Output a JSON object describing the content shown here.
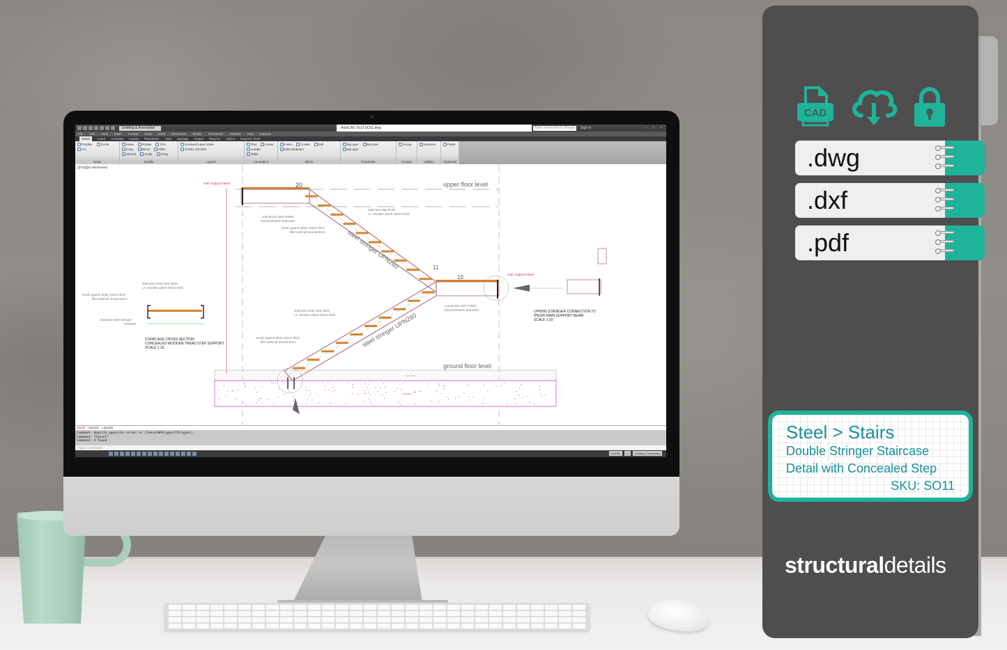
{
  "colors": {
    "brand_teal": "#1fb39a",
    "panel_dark": "#4e4e4f",
    "card_text": "#1a8f9c"
  },
  "product_panel": {
    "icons": [
      "cad-file-icon",
      "cloud-download-icon",
      "lock-icon"
    ],
    "cad_icon_text": "CAD",
    "formats": [
      ".dwg",
      ".dxf",
      ".pdf"
    ],
    "category": "Steel > Stairs",
    "title_line1": "Double Stringer Staircase",
    "title_line2": "Detail with Concealed Step",
    "sku": "SKU: SO11",
    "brand_bold": "structural",
    "brand_light": "details"
  },
  "autocad": {
    "quick_access": {
      "workspace": "Drafting & Annotation",
      "title": "AutoCAD 2013   SO11.dwg",
      "search_placeholder": "Type a keyword or phrase",
      "sign_in": "Sign In"
    },
    "menu": [
      "File",
      "Edit",
      "View",
      "Insert",
      "Format",
      "Tools",
      "Draw",
      "Dimension",
      "Modify",
      "Parametric",
      "Window",
      "Help",
      "Express"
    ],
    "ribbon_tabs": [
      "Home",
      "Insert",
      "Annotate",
      "Layout",
      "Parametric",
      "View",
      "Manage",
      "Output",
      "Plug-ins",
      "Online",
      "Express Tools"
    ],
    "panels": [
      {
        "title": "Draw",
        "commands": [
          "Polyline",
          "Circle",
          "Arc"
        ]
      },
      {
        "title": "Modify",
        "commands": [
          "Move",
          "Rotate",
          "Trim",
          "Copy",
          "Mirror",
          "Fillet",
          "Stretch",
          "Scale",
          "Array"
        ]
      },
      {
        "title": "Layers",
        "commands": [
          "Unsaved Layer State",
          "STEEL STAIRS"
        ]
      },
      {
        "title": "Annotation",
        "commands": [
          "Text",
          "Linear",
          "Leader",
          "Table"
        ]
      },
      {
        "title": "Block",
        "commands": [
          "Insert",
          "Create",
          "Edit",
          "Edit Attributes"
        ]
      },
      {
        "title": "Properties",
        "commands": [
          "ByLayer",
          "ByLayer",
          "ByLayer"
        ]
      },
      {
        "title": "Groups",
        "commands": [
          "Group"
        ]
      },
      {
        "title": "Utilities",
        "commands": [
          "Measure"
        ]
      },
      {
        "title": "Clipboard",
        "commands": [
          "Paste"
        ]
      }
    ],
    "viewport_label": "[-][Top][2D Wireframe]",
    "layout_tabs": [
      "Model",
      "Layout1",
      "Layout2"
    ],
    "command_history": [
      "Command: Specify opposite corner or [Fence/WPolygon/CPolygon]:",
      "Command: *Cancel*",
      "Command: 3 found"
    ],
    "command_placeholder": "Type a command",
    "status_right": [
      "MODEL",
      "1:1",
      "Drafting & Annotation"
    ]
  },
  "drawing": {
    "labels": {
      "upper_floor": "upper floor level",
      "ground_floor": "ground floor level",
      "stringer_upper": "steel stringer UPN260",
      "stringer_lower": "steel stringer UPN260",
      "step_20": "20",
      "step_11": "11",
      "step_10": "10",
      "main_beam_top": "main support beam",
      "main_beam_mid": "main support beam",
      "conn_fpbw_1": "connection with FPBW",
      "conn_fpbw_1b": "full penetration butt weld",
      "conn_fpbw_2": "connection with FPBW",
      "conn_fpbw_2b": "full penetration butt weld",
      "tread_plate_1": "tread support plate 10mm thick",
      "tread_plate_1b": "fillet weld all around 6mm",
      "tread_plate_2": "tread support plate 10mm thick",
      "tread_plate_2b": "fillet weld all around 6mm",
      "step_finish_1": "staircase step finish",
      "step_finish_1b": "i.e. wooden plank 40mm thick",
      "step_finish_2": "staircase tread step finish",
      "step_finish_2b": "i.e. wooden plank 40mm thick",
      "xs_finish": "staircase tread step finish",
      "xs_finishb": "i.e. wooden plank 40mm thick",
      "xs_plate": "tread support plate 10mm thick",
      "xs_plateb": "fillet weld all around 6mm",
      "xs_stringer": "staircase steel stringer",
      "xs_stringerb": "UPN260",
      "xs_title1": "STAIRCASE CROSS SECTION",
      "xs_title2": "CONCEALED WOODEN TREAD STEP SUPPORT",
      "xs_title3": "SCALE 1:10",
      "conn_title1": "UPN260 STRINGER CONNECTION TO",
      "conn_title2": "IPE300 MAIN SUPPORT BEAM",
      "conn_title3": "SCALE 1:10",
      "floor_finish": "floor finish",
      "foundation": "foundation"
    }
  }
}
